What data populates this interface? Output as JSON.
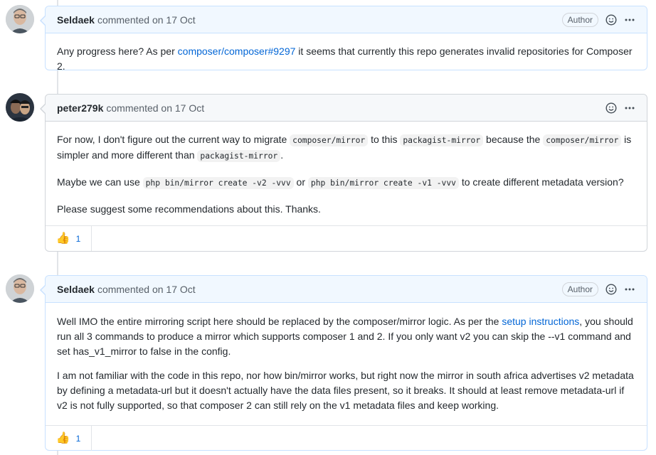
{
  "comments": [
    {
      "author": "Seldaek",
      "meta": "commented on 17 Oct",
      "badge": "Author",
      "body": {
        "p1_before": "Any progress here? As per ",
        "p1_link": "composer/composer#9297",
        "p1_after": " it seems that currently this repo generates invalid repositories for Composer 2."
      }
    },
    {
      "author": "peter279k",
      "meta": "commented on 17 Oct",
      "body": {
        "p1_a": "For now, I don't figure out the current way to migrate ",
        "p1_code1": "composer/mirror",
        "p1_b": " to this ",
        "p1_code2": "packagist-mirror",
        "p1_c": " because the ",
        "p1_code3": "composer/mirror",
        "p1_d": " is simpler and more different than ",
        "p1_code4": "packagist-mirror",
        "p1_e": ".",
        "p2_a": "Maybe we can use ",
        "p2_code1": "php bin/mirror create -v2 -vvv",
        "p2_b": " or ",
        "p2_code2": "php bin/mirror create -v1 -vvv",
        "p2_c": " to create different metadata version?",
        "p3": "Please suggest some recommendations about this. Thanks."
      },
      "reaction": {
        "icon": "thumbs-up",
        "emoji": "👍",
        "count": "1"
      }
    },
    {
      "author": "Seldaek",
      "meta": "commented on 17 Oct",
      "badge": "Author",
      "body": {
        "p1_a": "Well IMO the entire mirroring script here should be replaced by the composer/mirror logic. As per the ",
        "p1_link": "setup instructions",
        "p1_b": ", you should run all 3 commands to produce a mirror which supports composer 1 and 2. If you only want v2 you can skip the --v1 command and set has_v1_mirror to false in the config.",
        "p2": "I am not familiar with the code in this repo, nor how bin/mirror works, but right now the mirror in south africa advertises v2 metadata by defining a metadata-url but it doesn't actually have the data files present, so it breaks. It should at least remove metadata-url if v2 is not fully supported, so that composer 2 can still rely on the v1 metadata files and keep working."
      },
      "reaction": {
        "icon": "thumbs-up",
        "emoji": "👍",
        "count": "1"
      }
    }
  ],
  "icons": {
    "emoji": "smiley-icon",
    "more": "kebab-menu-icon"
  },
  "colors": {
    "link": "#0366d6",
    "self_header": "#f1f8ff",
    "header": "#f6f8fa",
    "border": "#d1d5da"
  }
}
